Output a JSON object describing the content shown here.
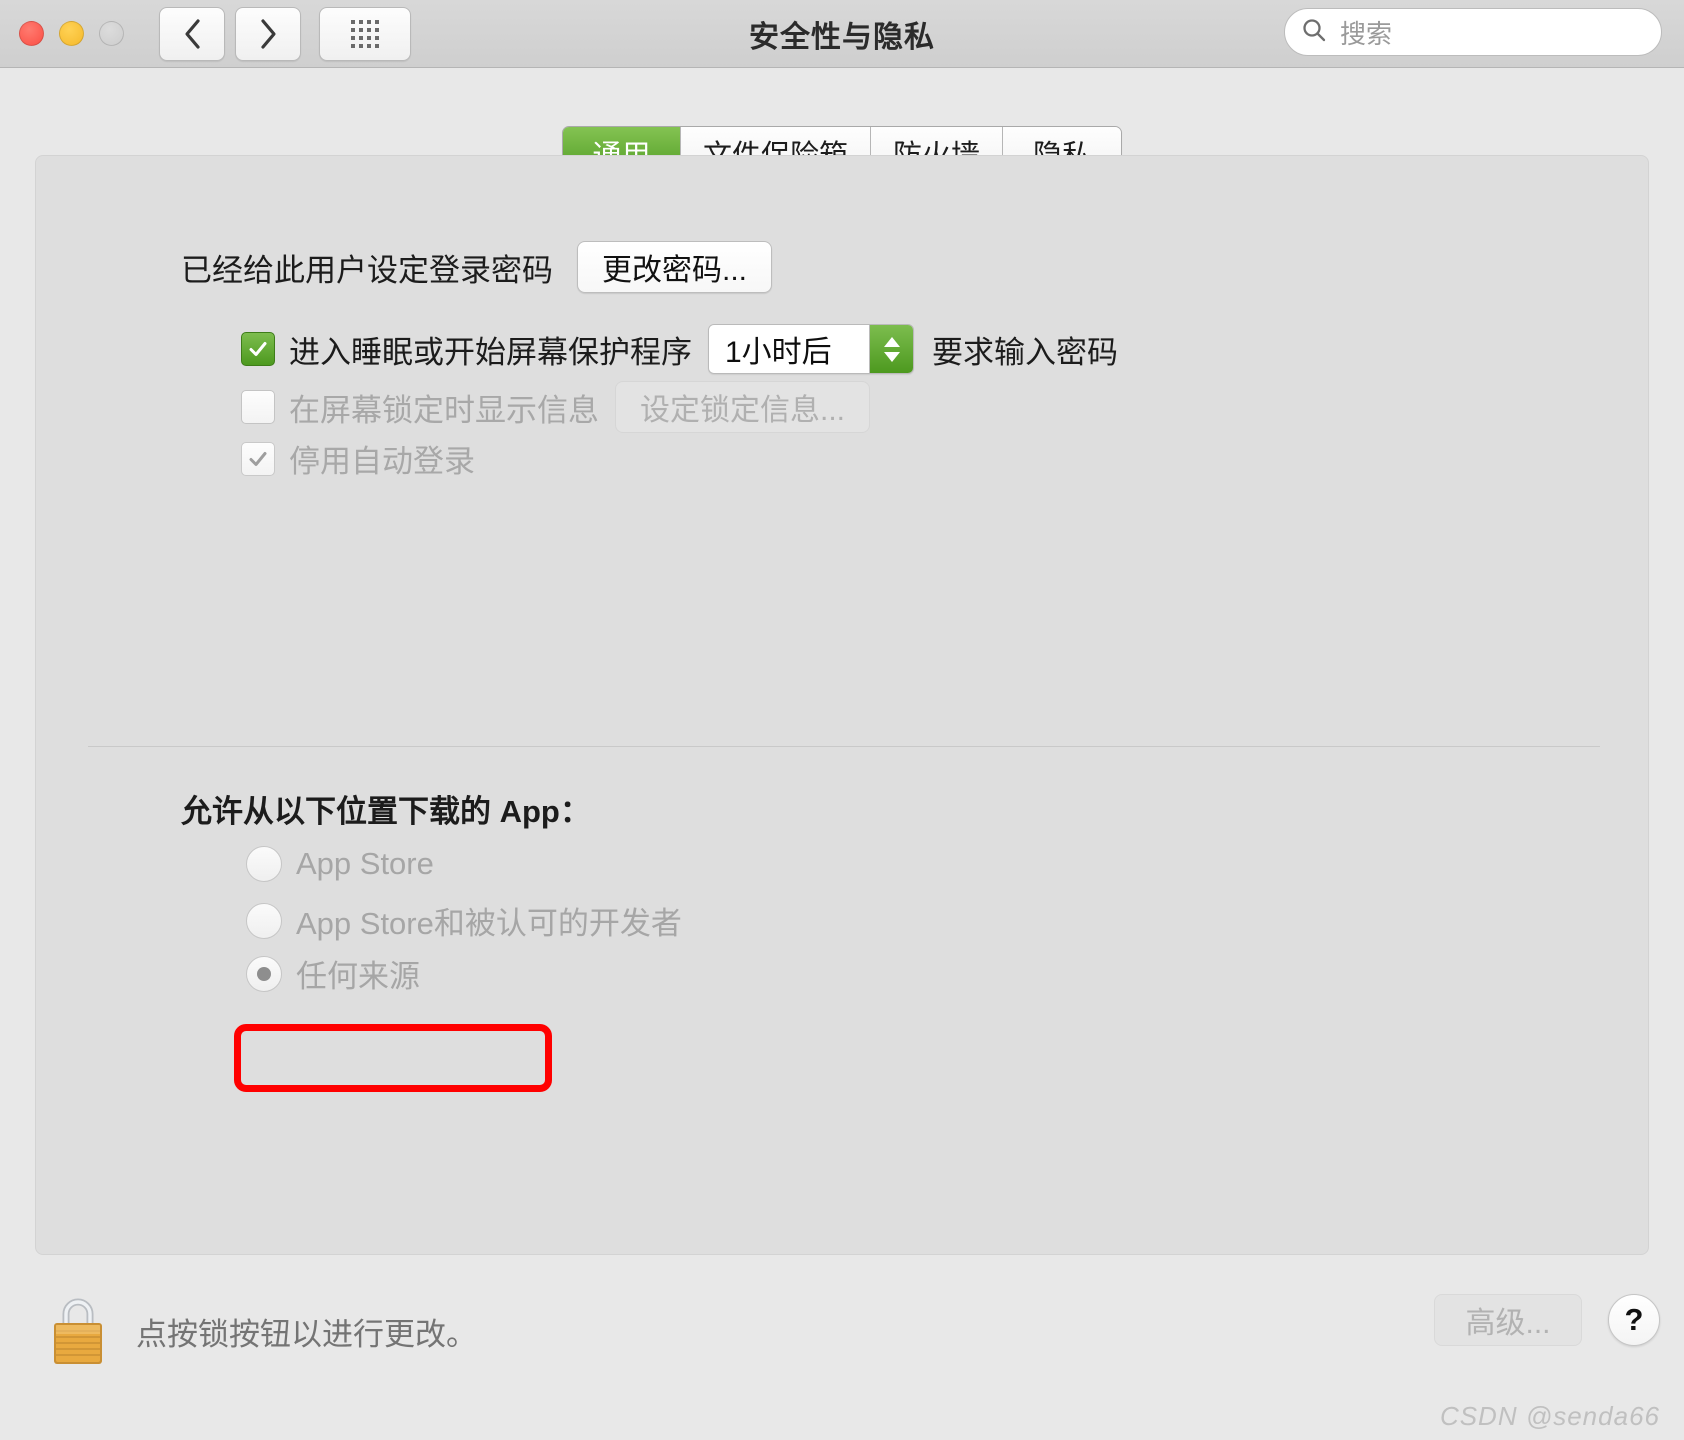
{
  "window": {
    "title": "安全性与隐私",
    "traffic_lights": [
      "close",
      "minimize",
      "zoom"
    ],
    "nav_back_icon": "chevron-left-icon",
    "nav_forward_icon": "chevron-right-icon",
    "grid_icon": "show-all-grid-icon"
  },
  "search": {
    "placeholder": "搜索",
    "icon": "search-icon",
    "value": ""
  },
  "tabs": [
    {
      "label": "通用",
      "active": true
    },
    {
      "label": "文件保险箱",
      "active": false
    },
    {
      "label": "防火墙",
      "active": false
    },
    {
      "label": "隐私",
      "active": false
    }
  ],
  "general": {
    "password_status": "已经给此用户设定登录密码",
    "change_password_button": "更改密码...",
    "require_password": {
      "checked": true,
      "enabled": true,
      "label": "进入睡眠或开始屏幕保护程序",
      "delay_value": "1小时后",
      "trailing_label": "要求输入密码"
    },
    "show_message": {
      "checked": false,
      "enabled": false,
      "label": "在屏幕锁定时显示信息",
      "button": "设定锁定信息..."
    },
    "disable_auto_login": {
      "checked": true,
      "enabled": false,
      "label": "停用自动登录"
    }
  },
  "download_sources": {
    "title": "允许从以下位置下载的 App：",
    "options": [
      {
        "label": "App Store",
        "selected": false,
        "enabled": false
      },
      {
        "label": "App Store和被认可的开发者",
        "selected": false,
        "enabled": false
      },
      {
        "label": "任何来源",
        "selected": true,
        "enabled": false
      }
    ],
    "highlight": {
      "color": "#ff0000",
      "target": "任何来源"
    }
  },
  "footer": {
    "lock_icon": "padlock-closed-icon",
    "lock_message": "点按锁按钮以进行更改。",
    "advanced_button": "高级...",
    "help_button": "?",
    "help_icon": "question-mark-icon"
  },
  "watermark": "CSDN @senda66",
  "colors": {
    "accent_green": "#4d991f",
    "highlight_red": "#ff0000",
    "window_bg": "#e8e8e8",
    "panel_bg": "#dedede"
  }
}
